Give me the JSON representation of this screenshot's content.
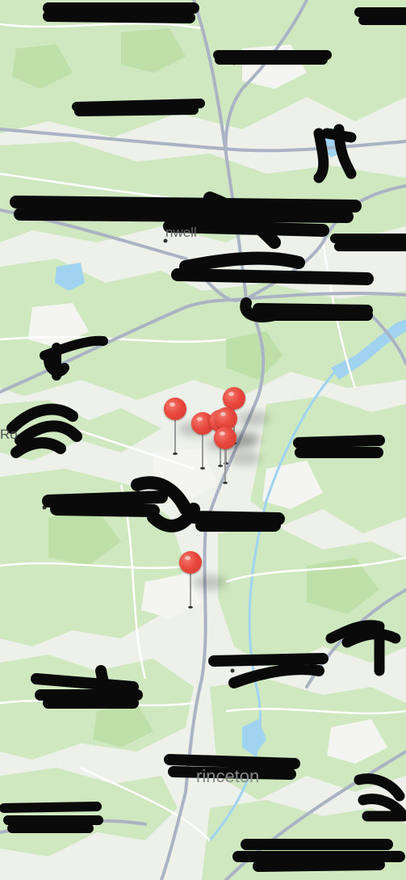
{
  "map": {
    "colors": {
      "land": "#eef0ea",
      "park": "#cfe8bf",
      "park_dark": "#bfdfa9",
      "road_major": "#aab3c4",
      "road_minor": "#ffffff",
      "water": "#9fd3f0",
      "pin": "#e8473c",
      "redaction": "#0a0a0a"
    },
    "visible_labels": [
      {
        "id": "label-rocky-hill",
        "text": "Ro"
      },
      {
        "id": "label-princeton",
        "text": "rinceton"
      },
      {
        "id": "label-hopewell-frag",
        "text": "nwell"
      }
    ],
    "pins": [
      {
        "id": "pin-1",
        "icon": "map-pin-icon"
      },
      {
        "id": "pin-2",
        "icon": "map-pin-icon"
      },
      {
        "id": "pin-3",
        "icon": "map-pin-icon"
      },
      {
        "id": "pin-4",
        "icon": "map-pin-icon"
      },
      {
        "id": "pin-5",
        "icon": "map-pin-icon"
      },
      {
        "id": "pin-6",
        "icon": "map-pin-icon"
      },
      {
        "id": "pin-7",
        "icon": "map-pin-icon"
      }
    ]
  }
}
